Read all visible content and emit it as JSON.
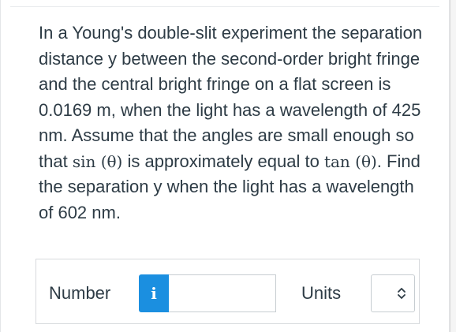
{
  "question": {
    "text_1": "In a Young's double-slit experiment the separation distance y between the second-order bright fringe and the central bright fringe on a flat screen is 0.0169 m, when the light has a wavelength of 425 nm. Assume that the angles are small enough so that ",
    "math_sin": "sin (θ)",
    "text_2": " is approximately equal to ",
    "math_tan": "tan (θ)",
    "text_3": ". Find the separation y when the light has a wavelength of 602 nm."
  },
  "answer": {
    "number_label": "Number",
    "info_label": "i",
    "number_value": "",
    "units_label": "Units",
    "units_selected": ""
  },
  "colors": {
    "info_button": "#1b8fe0",
    "text": "#2d3b45"
  },
  "icons": {
    "info": "info-icon",
    "select_arrows": "up-down-chevron-icon"
  }
}
